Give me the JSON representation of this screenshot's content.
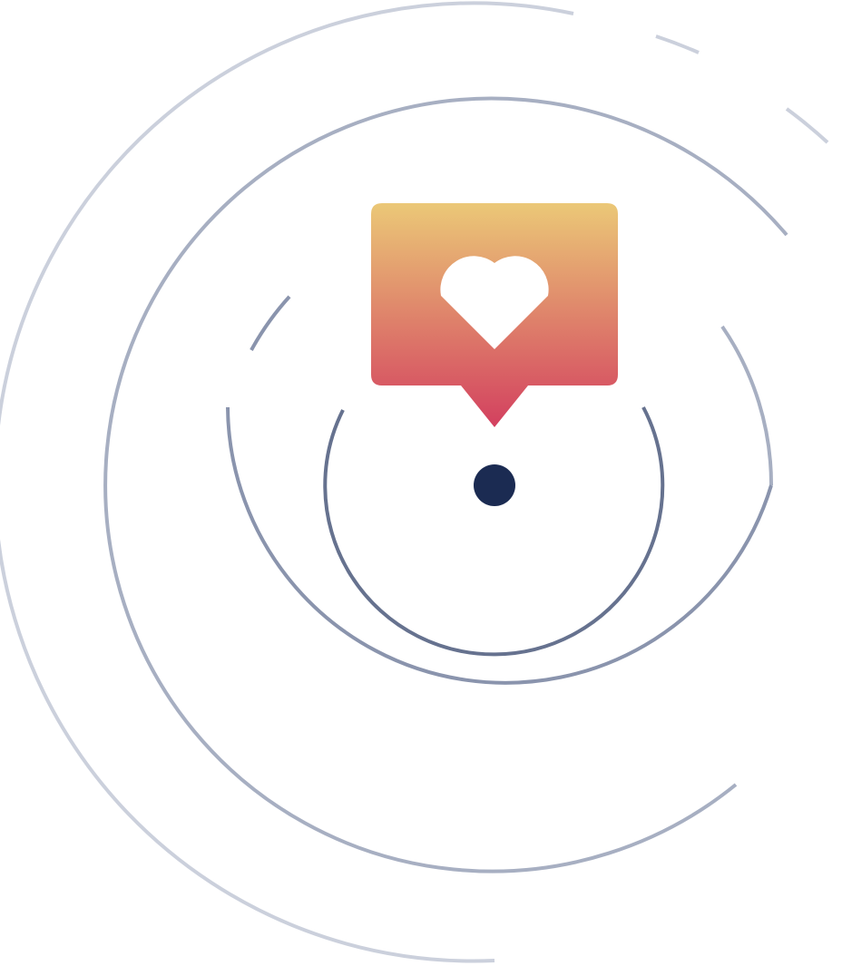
{
  "illustration": {
    "subject": "heart-notification-radar",
    "colors": {
      "ring_inner": "#66728f",
      "ring_middle": "#8a94ad",
      "ring_outer": "#a7afc2",
      "ring_outermost": "#cbd0dc",
      "center_dot": "#1b2b52",
      "bubble_top": "#ebc877",
      "bubble_bottom": "#d3405f",
      "heart": "#ffffff"
    },
    "icons": [
      "speech-bubble-icon",
      "heart-icon",
      "location-dot-icon"
    ]
  }
}
